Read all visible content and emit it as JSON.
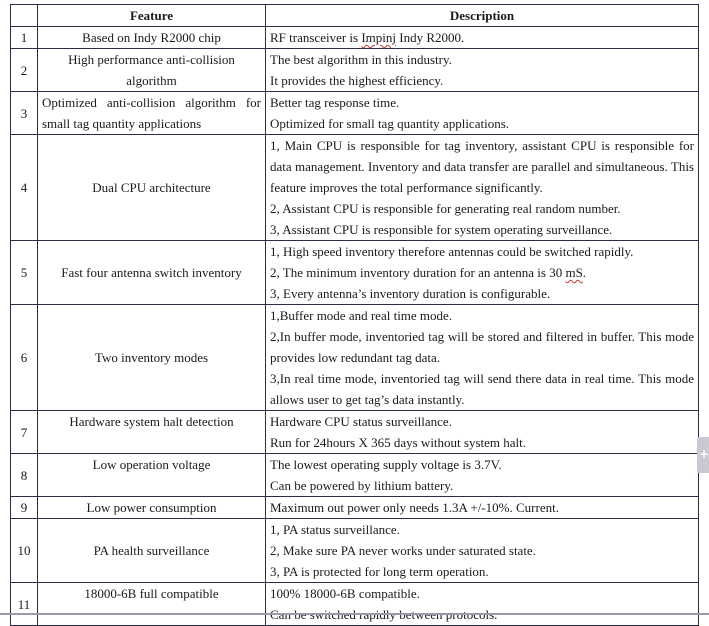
{
  "table": {
    "headers": {
      "index": "",
      "feature": "Feature",
      "description": "Description"
    },
    "rows": [
      {
        "no": "1",
        "feature": "Based on Indy R2000 chip",
        "description": [
          {
            "pre": "RF transceiver is ",
            "flag": "Impinj",
            "post": " Indy R2000."
          }
        ]
      },
      {
        "no": "2",
        "feature": "High performance anti-collision algorithm",
        "description": [
          {
            "text": "The best algorithm in this industry."
          },
          {
            "text": "It provides the highest efficiency."
          }
        ]
      },
      {
        "no": "3",
        "feature": "Optimized anti-collision algorithm for small tag quantity applications",
        "description": [
          {
            "text": "Better tag response time."
          },
          {
            "text": "Optimized for small tag quantity applications."
          }
        ]
      },
      {
        "no": "4",
        "feature": "Dual CPU architecture",
        "description": [
          {
            "text": "1, Main CPU is responsible for tag inventory, assistant CPU is responsible for data management. Inventory and data transfer are parallel and simultaneous. This feature improves the total performance significantly."
          },
          {
            "text": "2, Assistant CPU is responsible for generating real random number."
          },
          {
            "text": "3, Assistant CPU is responsible for system operating surveillance."
          }
        ]
      },
      {
        "no": "5",
        "feature": "Fast four antenna switch inventory",
        "description": [
          {
            "text": "1, High speed inventory therefore antennas could be switched rapidly."
          },
          {
            "pre": "2, The minimum inventory duration for an antenna is 30 ",
            "flag": "mS",
            "post": "."
          },
          {
            "text": "3, Every antenna’s inventory duration is configurable."
          }
        ]
      },
      {
        "no": "6",
        "feature": "Two inventory modes",
        "description": [
          {
            "text": "1,Buffer mode and real time mode."
          },
          {
            "text": "2,In buffer mode, inventoried tag will be stored and filtered in buffer. This mode provides low redundant tag data."
          },
          {
            "text": "3,In real time mode, inventoried tag will send there data in real time. This mode allows user to get tag’s data instantly."
          }
        ]
      },
      {
        "no": "7",
        "feature": "Hardware system halt detection",
        "description": [
          {
            "text": "Hardware CPU status surveillance."
          },
          {
            "text": "Run for 24hours X 365 days without system halt."
          }
        ]
      },
      {
        "no": "8",
        "feature": "Low operation voltage",
        "description": [
          {
            "text": "The lowest operating supply voltage is 3.7V."
          },
          {
            "text": "Can be powered by lithium battery."
          }
        ]
      },
      {
        "no": "9",
        "feature": "Low power consumption",
        "description": [
          {
            "text": "Maximum out power only needs 1.3A +/-10%. Current."
          }
        ]
      },
      {
        "no": "10",
        "feature": "PA health surveillance",
        "description": [
          {
            "text": "1, PA status surveillance."
          },
          {
            "text": "2, Make sure PA never works under saturated state."
          },
          {
            "text": "3, PA is protected for long term operation."
          }
        ]
      },
      {
        "no": "11",
        "feature": "18000-6B full compatible",
        "description": [
          {
            "text": "100% 18000-6B compatible."
          },
          {
            "text": "Can be switched rapidly between protocols."
          }
        ]
      }
    ]
  },
  "side_tab": {
    "icon": "plus-icon",
    "glyph": "+"
  }
}
